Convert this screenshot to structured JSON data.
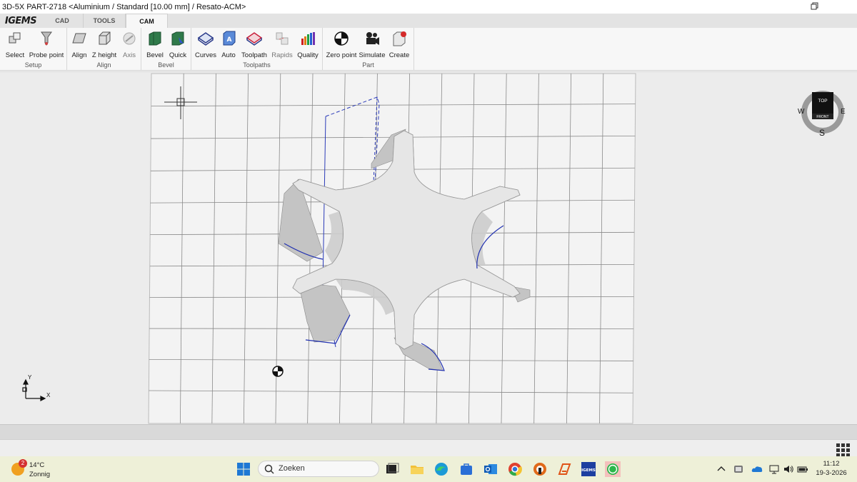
{
  "window": {
    "title": "3D-5X  PART-2718  <Aluminium / Standard [10.00 mm] / Resato-ACM>"
  },
  "app": {
    "logo": "IGEMS",
    "tabs": [
      {
        "label": "CAD",
        "active": false
      },
      {
        "label": "TOOLS",
        "active": false
      },
      {
        "label": "CAM",
        "active": true
      }
    ]
  },
  "ribbon": {
    "groups": [
      {
        "label": "Setup",
        "buttons": [
          {
            "label": "Select",
            "icon": "select-icon"
          },
          {
            "label": "Probe point",
            "icon": "probe-icon"
          }
        ]
      },
      {
        "label": "Align",
        "buttons": [
          {
            "label": "Align",
            "icon": "align-icon"
          },
          {
            "label": "Z height",
            "icon": "z-height-icon"
          },
          {
            "label": "Axis",
            "icon": "axis-icon",
            "disabled": true
          }
        ]
      },
      {
        "label": "Bevel",
        "buttons": [
          {
            "label": "Bevel",
            "icon": "bevel-icon"
          },
          {
            "label": "Quick",
            "icon": "quick-bevel-icon"
          }
        ]
      },
      {
        "label": "Toolpaths",
        "buttons": [
          {
            "label": "Curves",
            "icon": "curves-icon"
          },
          {
            "label": "Auto",
            "icon": "auto-icon"
          },
          {
            "label": "Toolpath",
            "icon": "toolpath-icon"
          },
          {
            "label": "Rapids",
            "icon": "rapids-icon",
            "disabled": true
          },
          {
            "label": "Quality",
            "icon": "quality-icon"
          }
        ]
      },
      {
        "label": "Part",
        "buttons": [
          {
            "label": "Zero point",
            "icon": "zero-point-icon"
          },
          {
            "label": "Simulate",
            "icon": "simulate-icon"
          },
          {
            "label": "Create",
            "icon": "create-icon"
          }
        ]
      }
    ]
  },
  "viewport": {
    "viewcube": {
      "top": "TOP",
      "front": "FRONT",
      "west": "W",
      "east": "E",
      "south": "S"
    },
    "axes": {
      "y": "Y",
      "x": "X"
    },
    "colors": {
      "toolpath": "#1b7a1b",
      "contour": "#1f2fb0",
      "part": "#cfcfcf"
    }
  },
  "taskbar": {
    "weather": {
      "badge": "2",
      "temp": "14°C",
      "condition": "Zonnig"
    },
    "search_placeholder": "Zoeken",
    "clock": {
      "time": "11:12",
      "date": "19-3-2026"
    }
  }
}
